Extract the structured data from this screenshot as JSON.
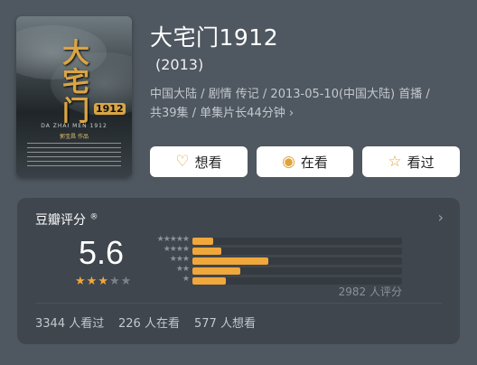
{
  "poster": {
    "title_chars": "大宅门",
    "subtitle": "1912",
    "english_title": "DA ZHAI MEN 1912",
    "credit": "郭宝昌 作品"
  },
  "movie": {
    "title": "大宅门1912",
    "year": "(2013)",
    "meta_line1": "中国大陆 / 剧情 传记 / 2013-05-10(中国大陆) 首播 /",
    "meta_line2": "共39集 / 单集片长44分钟",
    "meta_chevron": "›"
  },
  "actions": [
    {
      "label": "想看",
      "icon": "heart-plus-icon",
      "glyph": "♡"
    },
    {
      "label": "在看",
      "icon": "target-circle-icon",
      "glyph": "◉"
    },
    {
      "label": "看过",
      "icon": "star-outline-icon",
      "glyph": "☆"
    }
  ],
  "rating": {
    "section_title": "豆瓣评分",
    "registered": "®",
    "arrow": "›",
    "score": "5.6",
    "stars_filled": 3,
    "stars_total": 5,
    "distribution": [
      {
        "stars": "★★★★★",
        "percent": 10
      },
      {
        "stars": "★★★★",
        "percent": 14
      },
      {
        "stars": "★★★",
        "percent": 36
      },
      {
        "stars": "★★",
        "percent": 23
      },
      {
        "stars": "★",
        "percent": 16
      }
    ],
    "rating_count": "2982 人评分"
  },
  "stats": {
    "watched": "3344 人看过",
    "watching": "226 人在看",
    "want": "577 人想看"
  },
  "colors": {
    "background": "#4f5760",
    "panel": "#3f464d",
    "accent": "#f0a73b"
  }
}
